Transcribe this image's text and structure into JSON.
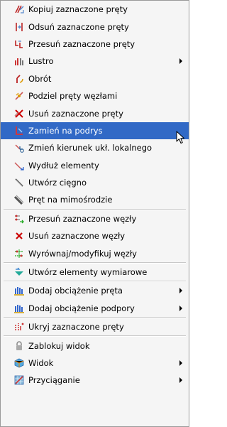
{
  "menu": {
    "items": [
      {
        "label": "Kopiuj zaznaczone pręty",
        "icon": "copy-bars-icon"
      },
      {
        "label": "Odsuń zaznaczone pręty",
        "icon": "offset-bars-icon"
      },
      {
        "label": "Przesuń zaznaczone pręty",
        "icon": "move-bars-icon"
      },
      {
        "label": "Lustro",
        "icon": "mirror-icon",
        "submenu": true
      },
      {
        "label": "Obrót",
        "icon": "rotate-icon"
      },
      {
        "label": "Podziel pręty węzłami",
        "icon": "split-bars-icon"
      },
      {
        "label": "Usuń zaznaczone pręty",
        "icon": "delete-bars-icon"
      },
      {
        "label": "Zamień na podrys",
        "icon": "convert-to-underlay-icon",
        "selected": true
      },
      {
        "label": "Zmień kierunek ukł. lokalnego",
        "icon": "change-local-axis-icon"
      },
      {
        "label": "Wydłuż elementy",
        "icon": "extend-elements-icon"
      },
      {
        "label": "Utwórz cięgno",
        "icon": "create-tendon-icon"
      },
      {
        "label": "Pręt na mimośrodzie",
        "icon": "eccentric-bar-icon"
      },
      {
        "label": "Przesuń zaznaczone węzły",
        "icon": "move-nodes-icon"
      },
      {
        "label": "Usuń zaznaczone węzły",
        "icon": "delete-nodes-icon"
      },
      {
        "label": "Wyrównaj/modyfikuj węzły",
        "icon": "align-nodes-icon"
      },
      {
        "label": "Utwórz elementy wymiarowe",
        "icon": "dimension-elements-icon"
      },
      {
        "label": "Dodaj obciążenie pręta",
        "icon": "bar-load-icon",
        "submenu": true
      },
      {
        "label": "Dodaj obciążenie podpory",
        "icon": "support-load-icon",
        "submenu": true
      },
      {
        "label": "Ukryj zaznaczone pręty",
        "icon": "hide-bars-icon"
      },
      {
        "label": "Zablokuj widok",
        "icon": "lock-view-icon"
      },
      {
        "label": "Widok",
        "icon": "view-icon",
        "submenu": true
      },
      {
        "label": "Przyciąganie",
        "icon": "snap-icon",
        "submenu": true
      }
    ]
  },
  "colors": {
    "highlight": "#3169c6",
    "menu_bg": "#f5f5f5"
  }
}
